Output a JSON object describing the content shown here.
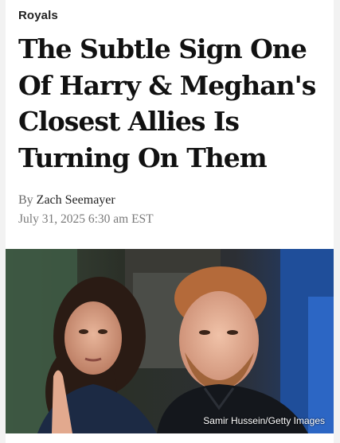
{
  "article": {
    "category": "Royals",
    "headline": "The Subtle Sign One Of Harry & Meghan's Closest Allies Is Turning On Them",
    "byline_prefix": "By",
    "author": "Zach Seemayer",
    "date": "July 31, 2025 6:30 am EST"
  },
  "photo": {
    "credit": "Samir Hussein/Getty Images"
  },
  "colors": {
    "page_background": "#f2f2f2",
    "card_background": "#ffffff",
    "headline_text": "#111111",
    "meta_text": "#7a7a7a"
  }
}
